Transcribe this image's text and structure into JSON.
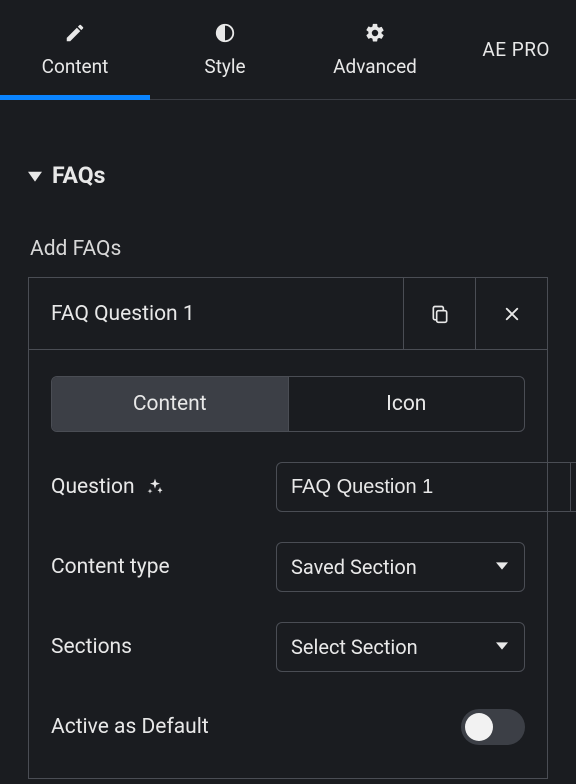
{
  "brand": "AE PRO",
  "tabs": [
    {
      "id": "content",
      "label": "Content",
      "active": true
    },
    {
      "id": "style",
      "label": "Style",
      "active": false
    },
    {
      "id": "advanced",
      "label": "Advanced",
      "active": false
    }
  ],
  "section": {
    "title": "FAQs",
    "expanded": true
  },
  "add_faqs_label": "Add FAQs",
  "repeater_item": {
    "title": "FAQ Question 1",
    "inner_tabs": [
      {
        "id": "content",
        "label": "Content",
        "active": true
      },
      {
        "id": "icon",
        "label": "Icon",
        "active": false
      }
    ],
    "question": {
      "label": "Question",
      "value": "FAQ Question 1"
    },
    "content_type": {
      "label": "Content type",
      "value": "Saved Section"
    },
    "sections": {
      "label": "Sections",
      "value": "Select Section"
    },
    "active_default": {
      "label": "Active as Default",
      "value": false
    }
  }
}
